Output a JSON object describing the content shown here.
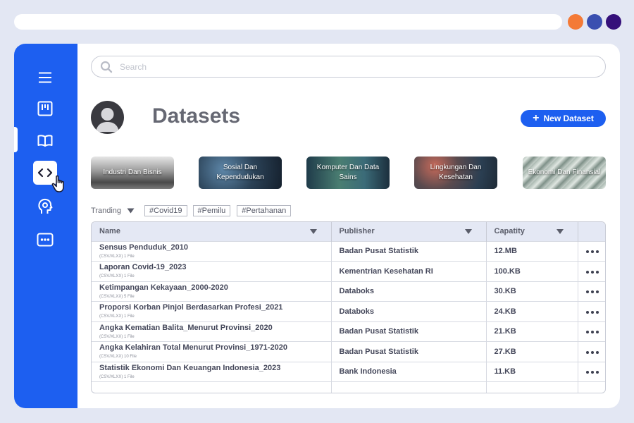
{
  "window_controls": [
    {
      "name": "orange",
      "color": "#f47a36"
    },
    {
      "name": "blue",
      "color": "#3a4fb0"
    },
    {
      "name": "purple",
      "color": "#35107a"
    }
  ],
  "colors": {
    "accent": "#1d5ff0",
    "background": "#e3e7f3"
  },
  "sidebar": {
    "items": [
      {
        "name": "menu-icon"
      },
      {
        "name": "board-icon"
      },
      {
        "name": "book-icon"
      },
      {
        "name": "code-icon",
        "active": true
      },
      {
        "name": "head-gear-icon"
      },
      {
        "name": "more-box-icon"
      }
    ]
  },
  "search": {
    "placeholder": "Search",
    "value": ""
  },
  "header": {
    "title": "Datasets",
    "new_button": "New Dataset"
  },
  "categories": [
    {
      "label": "Industri Dan Bisnis"
    },
    {
      "label": "Sosial Dan Kependudukan"
    },
    {
      "label": "Komputer Dan Data Sains"
    },
    {
      "label": "Lingkungan Dan Kesehatan"
    },
    {
      "label": "Ekonomi Dan Finansial"
    }
  ],
  "filters": {
    "label": "Tranding",
    "tags": [
      "#Covid19",
      "#Pemilu",
      "#Pertahanan"
    ]
  },
  "table": {
    "columns": [
      "Name",
      "Publisher",
      "Capatity"
    ],
    "rows": [
      {
        "name": "Sensus Penduduk_2010",
        "meta": "(CSV/XLXX) 1 File",
        "publisher": "Badan Pusat Statistik",
        "capacity": "12.MB"
      },
      {
        "name": "Laporan Covid-19_2023",
        "meta": "(CSV/XLXX) 1 File",
        "publisher": "Kementrian Kesehatan RI",
        "capacity": "100.KB"
      },
      {
        "name": "Ketimpangan Kekayaan_2000-2020",
        "meta": "(CSV/XLXX) 5 File",
        "publisher": "Databoks",
        "capacity": "30.KB"
      },
      {
        "name": "Proporsi Korban Pinjol Berdasarkan Profesi_2021",
        "meta": "(CSV/XLXX) 1 File",
        "publisher": "Databoks",
        "capacity": "24.KB"
      },
      {
        "name": "Angka Kematian Balita_Menurut Provinsi_2020",
        "meta": "(CSV/XLXX) 1 File",
        "publisher": "Badan Pusat Statistik",
        "capacity": "21.KB"
      },
      {
        "name": "Angka Kelahiran Total Menurut Provinsi_1971-2020",
        "meta": "(CSV/XLXX) 10 File",
        "publisher": "Badan Pusat Statistik",
        "capacity": "27.KB"
      },
      {
        "name": "Statistik Ekonomi Dan Keuangan Indonesia_2023",
        "meta": "(CSV/XLXX) 1 File",
        "publisher": "Bank Indonesia",
        "capacity": "11.KB"
      }
    ]
  }
}
